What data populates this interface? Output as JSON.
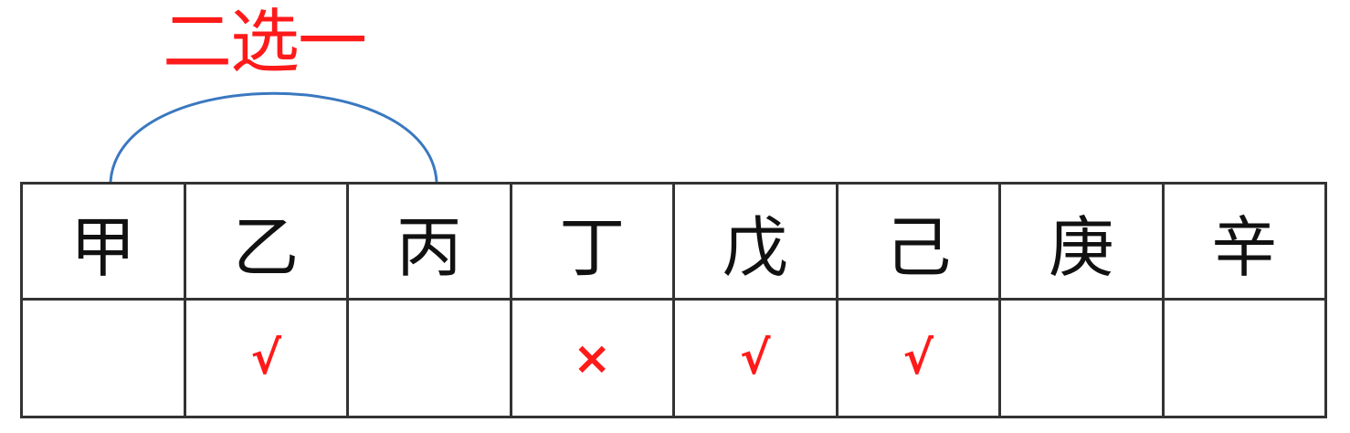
{
  "annotation": {
    "label": "二选一",
    "label_color": "#ff1a1a",
    "bracket_color": "#3a78c0",
    "spans": [
      "甲",
      "丙"
    ]
  },
  "table": {
    "headers": [
      "甲",
      "乙",
      "丙",
      "丁",
      "戊",
      "己",
      "庚",
      "辛"
    ],
    "marks": [
      "",
      "√",
      "",
      "×",
      "√",
      "√",
      "",
      ""
    ],
    "mark_color": "#ff1a1a",
    "border_color": "#333333"
  }
}
